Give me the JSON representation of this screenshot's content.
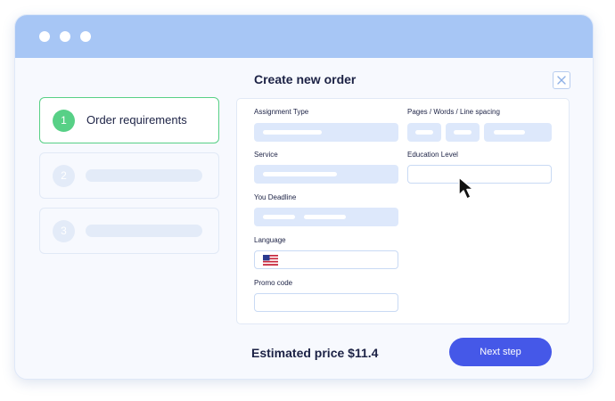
{
  "window": {
    "title": "Create new order"
  },
  "steps": [
    {
      "number": "1",
      "label": "Order requirements",
      "active": true
    },
    {
      "number": "2",
      "label": "",
      "active": false
    },
    {
      "number": "3",
      "label": "",
      "active": false
    }
  ],
  "form": {
    "assignment_type_label": "Assignment Type",
    "pages_label": "Pages / Words / Line spacing",
    "service_label": "Service",
    "education_label": "Education Level",
    "deadline_label": "You Deadline",
    "language_label": "Language",
    "promo_label": "Promo code"
  },
  "footer": {
    "estimated_price": "Estimated price $11.4",
    "next_label": "Next step"
  },
  "colors": {
    "titlebar": "#a7c6f5",
    "accent_green": "#57d086",
    "primary_button": "#4558e8",
    "field_fill": "#dde8fb"
  }
}
